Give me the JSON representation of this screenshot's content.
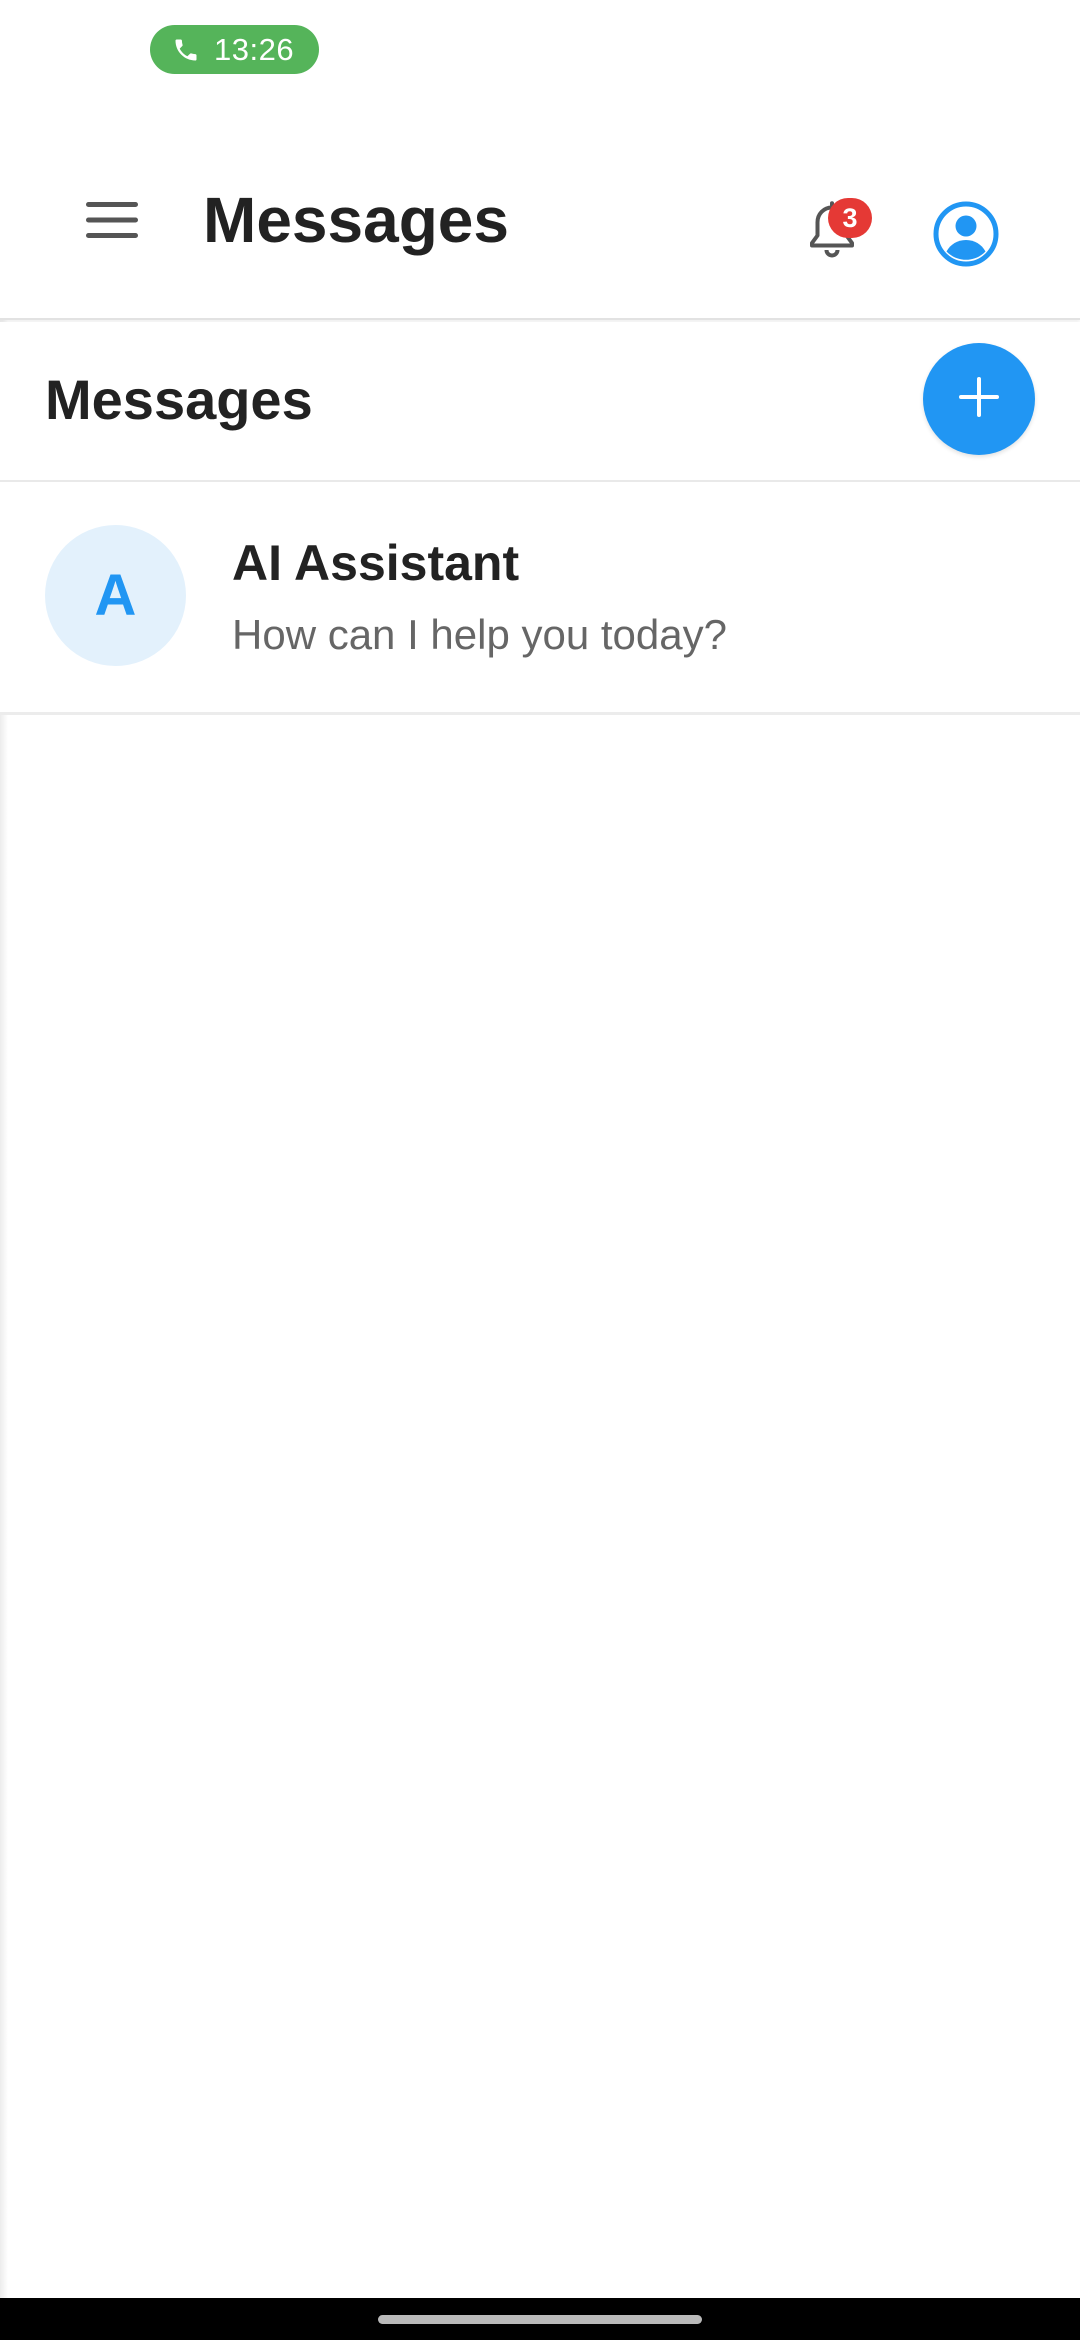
{
  "status_bar": {
    "call_time": "13:26",
    "call_icon": "phone-icon",
    "pill_color": "#55b45a"
  },
  "app_bar": {
    "title": "Messages",
    "menu_icon": "hamburger-menu-icon",
    "notifications_icon": "bell-icon",
    "notification_count": "3",
    "account_icon": "account-circle-icon"
  },
  "section": {
    "title": "Messages",
    "add_icon": "plus-icon"
  },
  "conversations": [
    {
      "avatar_letter": "A",
      "name": "AI Assistant",
      "preview": "How can I help you today?"
    }
  ],
  "colors": {
    "accent": "#2196f3",
    "badge": "#e53935",
    "avatar_bg": "#e3f1fc"
  }
}
